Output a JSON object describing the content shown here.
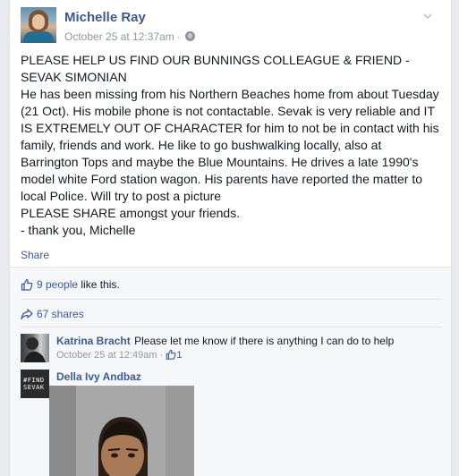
{
  "post": {
    "author": "Michelle Ray",
    "timestamp": "October 25 at 12:37am",
    "separator": "·",
    "paragraphs": [
      "PLEASE HELP US FIND OUR BUNNINGS COLLEAGUE & FRIEND - SEVAK SIMONIAN",
      "He has been missing from his Northern Beaches home from about Tuesday (21 Oct). His mobile phone is not contactable. Sevak is very reliable and IT IS EXTREMELY OUT OF CHARACTER for him to not be in contact with his family, friends and work. He like to go bushwalking locally, also at Barrington Tops and maybe the Blue Mountains. He drives a late 1990's model white Ford station wagon. His parents have reported the matter to local Police. Will try to post a picture",
      "PLEASE SHARE amongst your friends.",
      "- thank you, Michelle"
    ],
    "share_label": "Share"
  },
  "ufi": {
    "likes_link": "9 people",
    "likes_suffix": " like this.",
    "shares": "67 shares"
  },
  "comments": [
    {
      "author": "Katrina Bracht",
      "text": "Please let me know if there is anything I can do to help",
      "timestamp": "October 25 at 12:49am",
      "separator": "·",
      "like_count": "1"
    },
    {
      "author": "Della Ivy Andbaz",
      "avatar_text": [
        "#FIND",
        "SEVAK"
      ]
    }
  ],
  "colors": {
    "link": "#3b5998",
    "meta": "#9197a3",
    "background": "#e9eaed"
  },
  "icons": {
    "globe": "globe-icon",
    "chevron": "chevron-down-icon",
    "like": "thumbs-up-icon",
    "share": "share-arrow-icon"
  }
}
